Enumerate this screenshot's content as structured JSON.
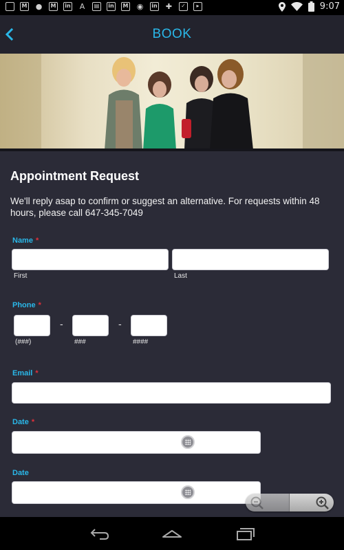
{
  "status_bar": {
    "left_icons": [
      "image-icon",
      "gmail-icon",
      "hangouts-icon",
      "gmail-icon",
      "linkedin-icon",
      "a-icon",
      "news-icon",
      "linkedin-icon",
      "gmail-icon",
      "sports-icon",
      "linkedin-icon",
      "plus-icon",
      "check-icon",
      "bag-icon"
    ],
    "time": "9:07"
  },
  "app_bar": {
    "title": "BOOK"
  },
  "form": {
    "title": "Appointment Request",
    "description": "We'll reply asap to confirm or suggest an alternative. For requests within 48 hours, please call 647-345-7049",
    "name": {
      "label": "Name",
      "required_mark": "*",
      "first_sublabel": "First",
      "last_sublabel": "Last",
      "first_value": "",
      "last_value": ""
    },
    "phone": {
      "label": "Phone",
      "required_mark": "*",
      "area_sublabel": "(###)",
      "prefix_sublabel": "###",
      "line_sublabel": "####",
      "separator": "-"
    },
    "email": {
      "label": "Email",
      "required_mark": "*",
      "value": ""
    },
    "date1": {
      "label": "Date",
      "required_mark": "*",
      "value": ""
    },
    "date2": {
      "label": "Date",
      "value": ""
    }
  },
  "colors": {
    "accent": "#2ab7e8",
    "background": "#2b2b37",
    "app_bar": "#23232d",
    "required": "#e0303a"
  }
}
